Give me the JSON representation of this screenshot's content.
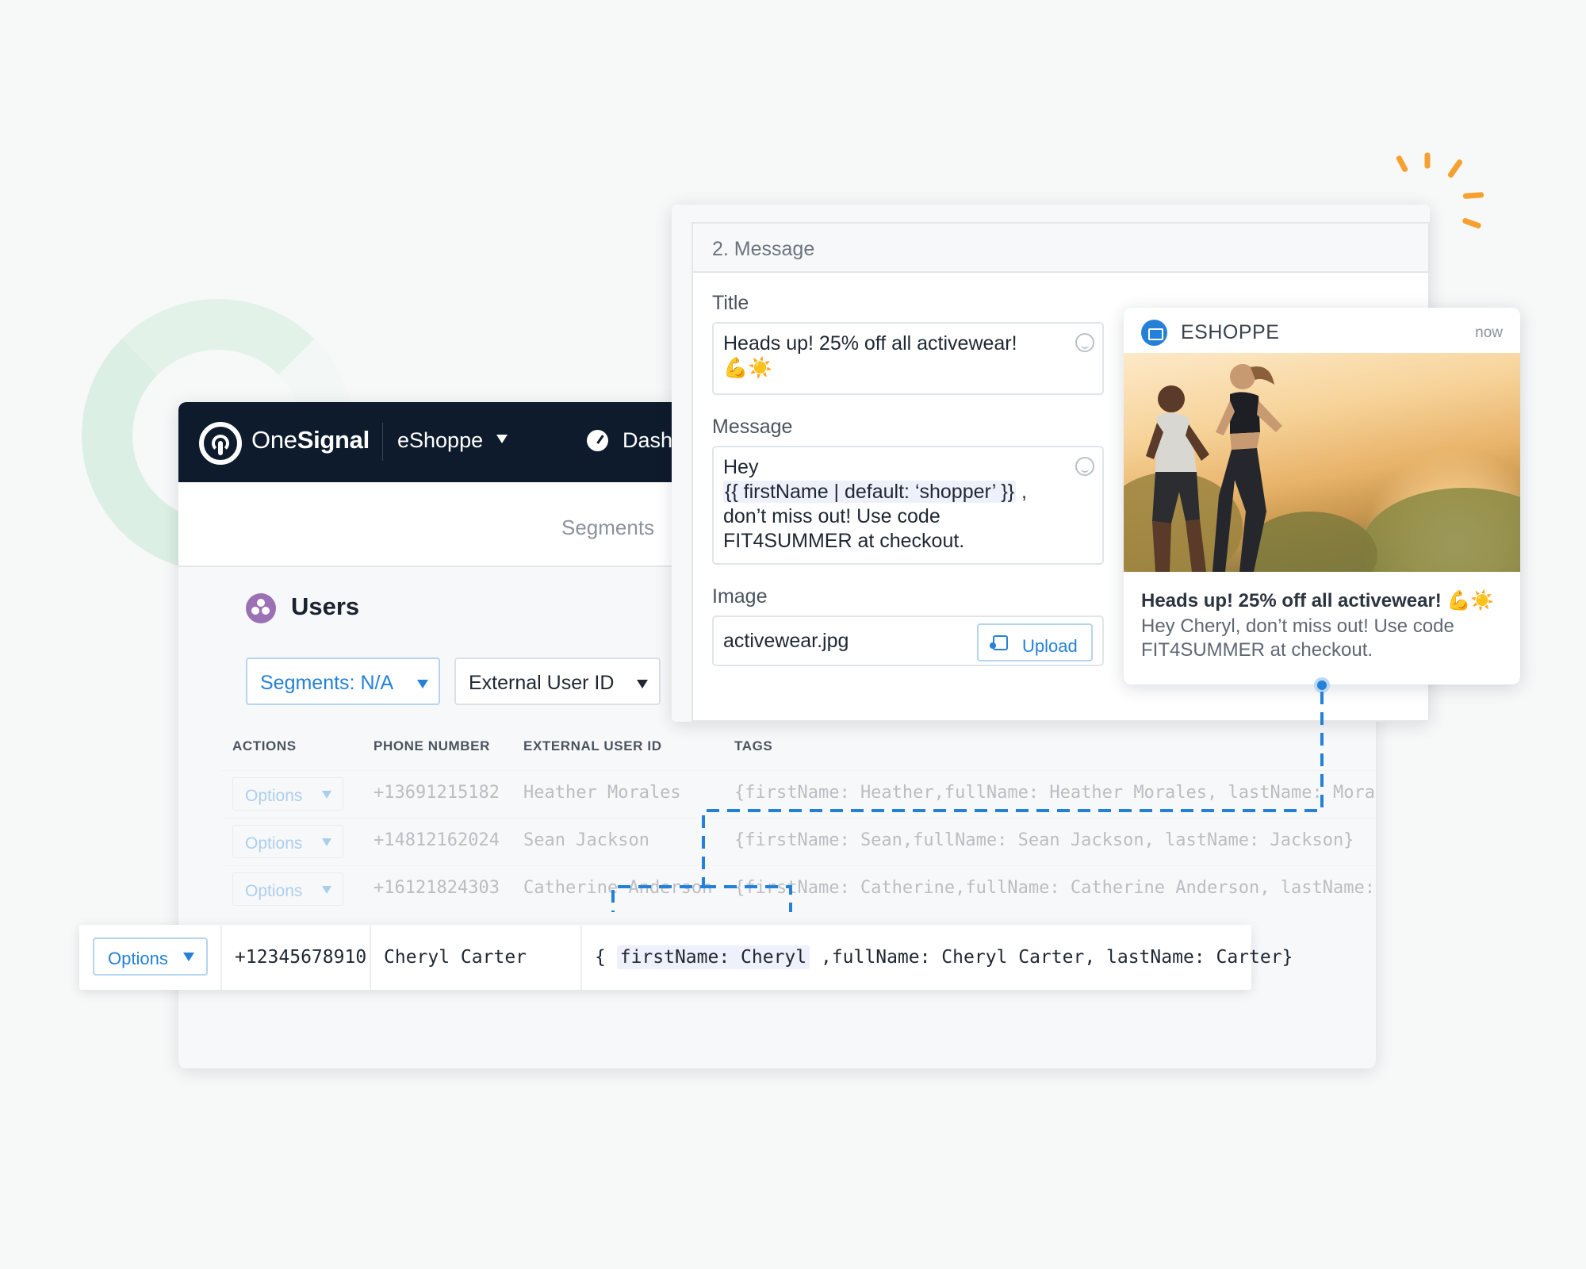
{
  "brand": {
    "name_light": "One",
    "name_bold": "Signal"
  },
  "header": {
    "app_name": "eShoppe",
    "nav_dashboard": "Dash"
  },
  "subnav": {
    "segments": "Segments"
  },
  "users": {
    "title": "Users",
    "segments_filter": "Segments: N/A",
    "external_id_filter": "External User ID",
    "columns": [
      "ACTIONS",
      "PHONE NUMBER",
      "EXTERNAL USER ID",
      "TAGS"
    ],
    "rows": [
      {
        "options": "Options",
        "phone": "+13691215182",
        "external_id": "Heather Morales",
        "tags": "{firstName: Heather,fullName: Heather Morales, lastName: Morale"
      },
      {
        "options": "Options",
        "phone": "+14812162024",
        "external_id": "Sean Jackson",
        "tags": "{firstName: Sean,fullName: Sean Jackson, lastName: Jackson}"
      },
      {
        "options": "Options",
        "phone": "+16121824303",
        "external_id": "Catherine Anderson",
        "tags": "{firstName: Catherine,fullName: Catherine Anderson, lastName: A"
      }
    ],
    "highlight": {
      "options": "Options",
      "phone": "+12345678910",
      "external_id": "Cheryl Carter",
      "tags_open": "{",
      "tags_var": "firstName: Cheryl",
      "tags_rest": ",fullName: Cheryl Carter, lastName: Carter}"
    }
  },
  "message": {
    "section": "2. Message",
    "title_label": "Title",
    "title_value": "Heads up! 25% off all activewear!",
    "title_emoji": "💪☀️",
    "message_label": "Message",
    "message_line1": "Hey",
    "message_var": "{{ firstName | default: ‘shopper’ }}",
    "message_comma": ",",
    "message_line3": "don’t miss out! Use code",
    "message_line4": "FIT4SUMMER at checkout.",
    "image_label": "Image",
    "image_value": "activewear.jpg",
    "upload_label": "Upload"
  },
  "notification": {
    "app": "ESHOPPE",
    "time": "now",
    "title": "Heads up! 25% off all activewear! 💪☀️",
    "body": "Hey Cheryl, don’t miss out! Use code FIT4SUMMER at checkout."
  },
  "colors": {
    "accent": "#2481d7",
    "header_bg": "#0d1b2c",
    "users_icon": "#9c70b5",
    "sparkle": "#f5a030",
    "ring": "#dcefe4"
  },
  "icons": [
    "onesignal-logo-icon",
    "dashboard-gauge-icon",
    "users-group-icon",
    "emoji-picker-icon",
    "upload-icon",
    "eshoppe-basket-icon",
    "caret-down-icon"
  ]
}
